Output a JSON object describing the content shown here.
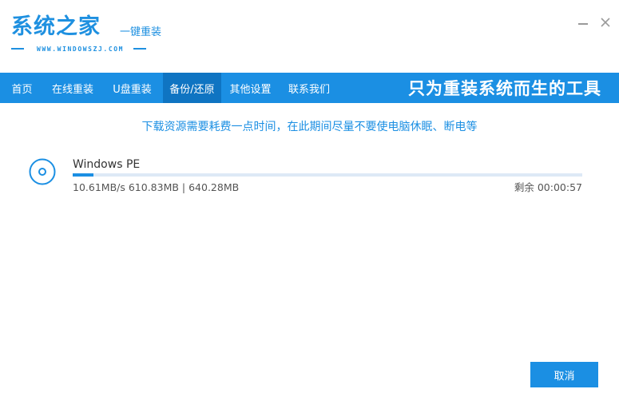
{
  "app": {
    "logo_title": "系统之家",
    "logo_slogan": "一键重装",
    "logo_url": "WWW.WINDOWSZJ.COM",
    "accent_color": "#1b8fe3"
  },
  "window_controls": {
    "minimize_icon": "minimize-icon",
    "close_icon": "close-icon"
  },
  "nav": {
    "items": [
      {
        "label": "首页",
        "active": false
      },
      {
        "label": "在线重装",
        "active": false
      },
      {
        "label": "U盘重装",
        "active": false
      },
      {
        "label": "备份/还原",
        "active": true
      },
      {
        "label": "其他设置",
        "active": false
      },
      {
        "label": "联系我们",
        "active": false
      }
    ],
    "slogan": "只为重装系统而生的工具"
  },
  "main": {
    "notice": "下载资源需要耗费一点时间，在此期间尽量不要使电脑休眠、断电等",
    "download": {
      "icon": "disc-icon",
      "name": "Windows PE",
      "progress": 0.04,
      "stats": "10.61MB/s 610.83MB | 640.28MB",
      "remaining": "剩余 00:00:57"
    }
  },
  "footer": {
    "cancel_label": "取消"
  }
}
